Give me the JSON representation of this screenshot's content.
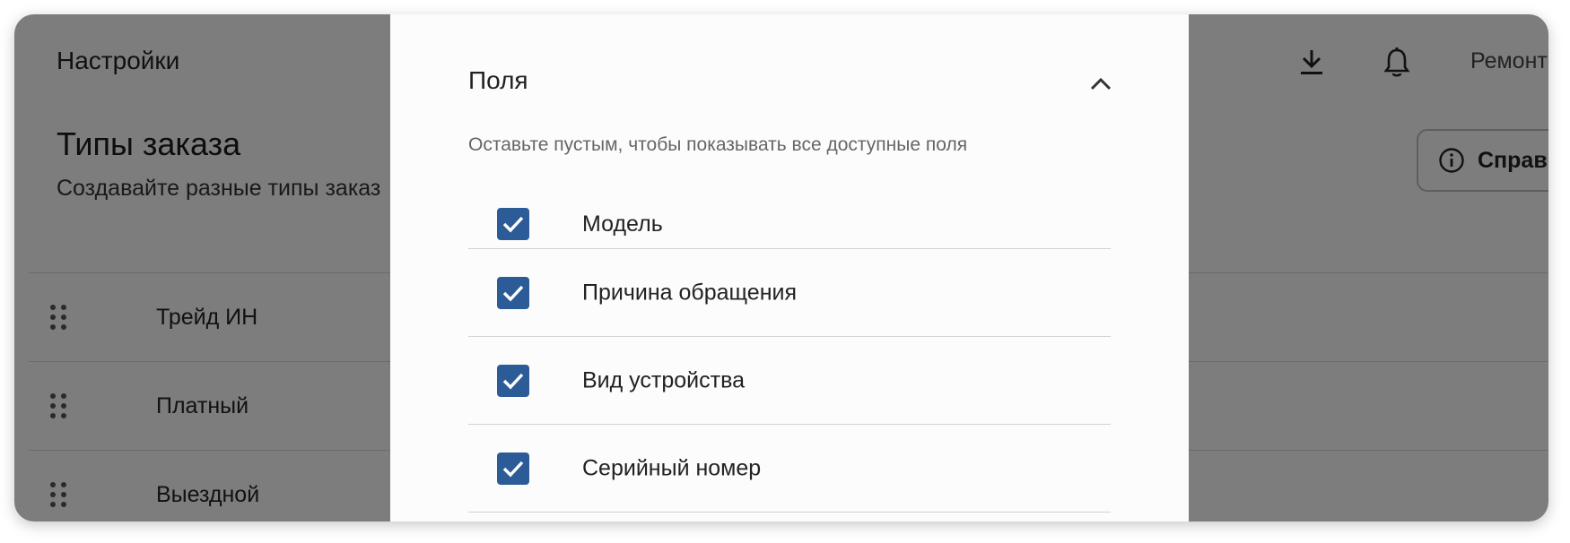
{
  "header": {
    "title": "Настройки",
    "download_icon": "download-icon",
    "notification_icon": "bell-icon",
    "account_label": "Ремонт"
  },
  "section": {
    "title": "Типы заказа",
    "subtitle": "Создавайте разные типы заказ",
    "help_label": "Справ",
    "help_icon": "info-icon"
  },
  "order_types": [
    {
      "name": "Трейд ИН"
    },
    {
      "name": "Платный"
    },
    {
      "name": "Выездной"
    }
  ],
  "drawer": {
    "title": "Поля",
    "collapse_icon": "chevron-up-icon",
    "hint": "Оставьте пустым, чтобы показывать все доступные поля",
    "fields": [
      {
        "label": "Модель",
        "checked": true
      },
      {
        "label": "Причина обращения",
        "checked": true
      },
      {
        "label": "Вид устройства",
        "checked": true
      },
      {
        "label": "Серийный номер",
        "checked": true
      }
    ]
  },
  "colors": {
    "checkbox": "#2b5c97",
    "scrim": "rgba(0,0,0,0.5)",
    "drawer_bg": "#fcfcfc"
  }
}
